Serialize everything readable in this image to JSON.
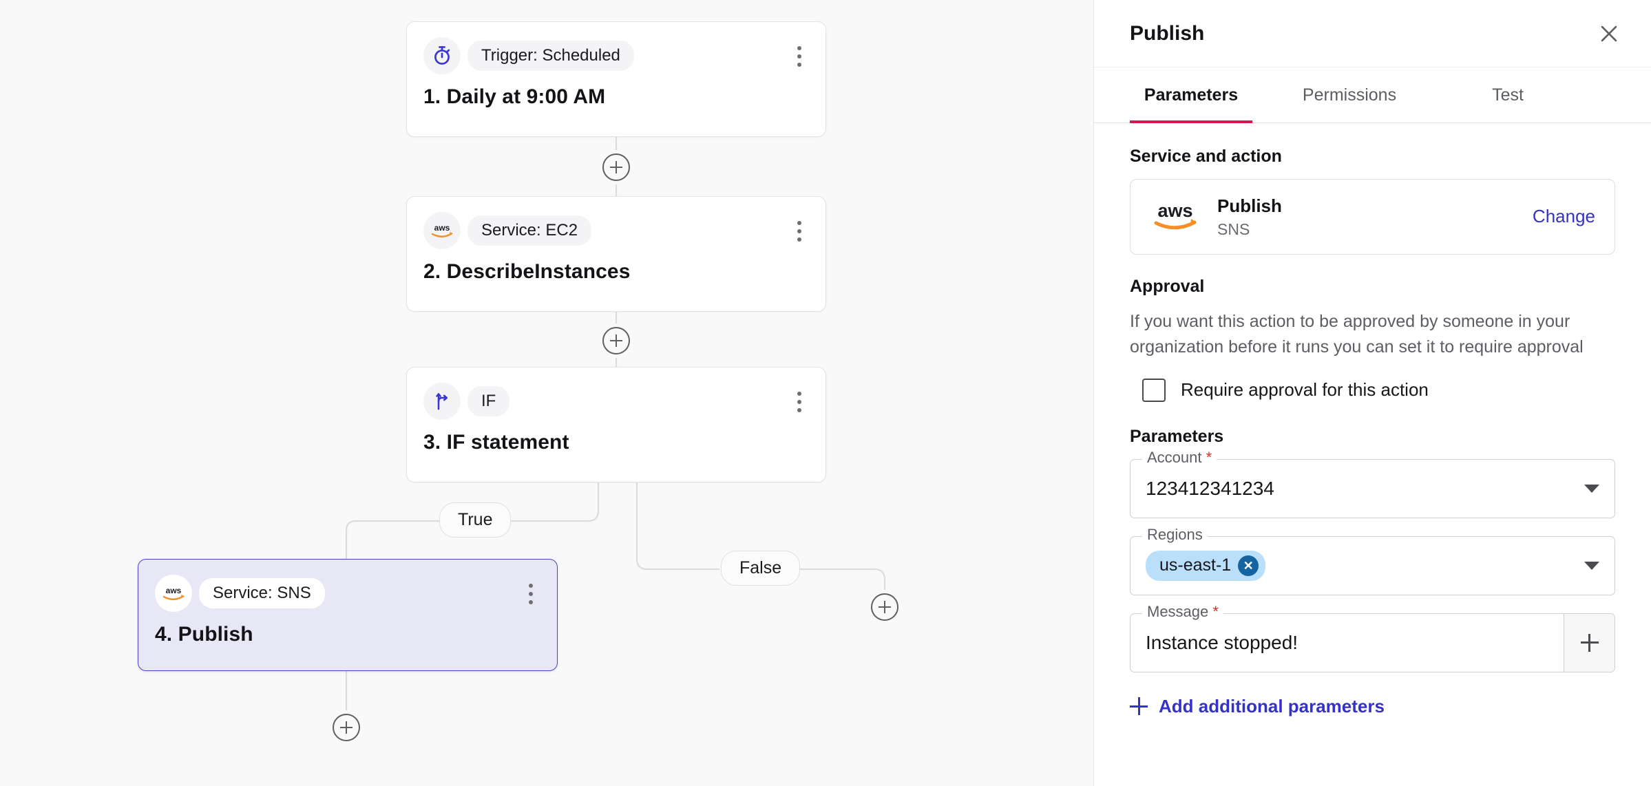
{
  "canvas": {
    "nodes": [
      {
        "id": "trigger",
        "icon": "stopwatch-icon",
        "chip": "Trigger: Scheduled",
        "title": "1. Daily at 9:00 AM",
        "selected": false
      },
      {
        "id": "ec2",
        "icon": "aws-logo-icon",
        "chip": "Service: EC2",
        "title": "2. DescribeInstances",
        "selected": false
      },
      {
        "id": "if",
        "icon": "branch-fork-icon",
        "chip": "IF",
        "title": "3. IF statement",
        "selected": false
      },
      {
        "id": "sns",
        "icon": "aws-logo-icon",
        "chip": "Service: SNS",
        "title": "4. Publish",
        "selected": true
      }
    ],
    "branch_labels": {
      "true": "True",
      "false": "False"
    },
    "add_step_label": "+"
  },
  "panel": {
    "title": "Publish",
    "close_icon": "close-icon",
    "tabs": [
      {
        "label": "Parameters",
        "active": true
      },
      {
        "label": "Permissions",
        "active": false
      },
      {
        "label": "Test",
        "active": false
      }
    ],
    "service_section": {
      "heading": "Service and action",
      "logo": "aws-logo-icon",
      "action_name": "Publish",
      "service_name": "SNS",
      "change_label": "Change"
    },
    "approval_section": {
      "heading": "Approval",
      "description": "If you want this action to be approved by someone in your organization before it runs you can set it to require approval",
      "checkbox_label": "Require approval for this action",
      "checked": false
    },
    "parameters_section": {
      "heading": "Parameters",
      "fields": [
        {
          "label": "Account",
          "required": true,
          "type": "select",
          "value": "123412341234"
        },
        {
          "label": "Regions",
          "required": false,
          "type": "multiselect",
          "chips": [
            "us-east-1"
          ]
        },
        {
          "label": "Message",
          "required": true,
          "type": "text-append",
          "value": "Instance stopped!",
          "append_icon": "plus-icon"
        }
      ],
      "add_parameters_label": "Add additional parameters"
    }
  },
  "colors": {
    "accent_tab_underline": "#d01a4e",
    "link_blue": "#3532c7",
    "selected_node_bg": "#e7e7f5",
    "selected_node_border": "#4b45c6",
    "chip_blue": "#b9dffb",
    "chip_x_blue": "#15639f",
    "required_red": "#d93025",
    "aws_orange": "#f59029",
    "canvas_bg": "#f9f9fa"
  }
}
